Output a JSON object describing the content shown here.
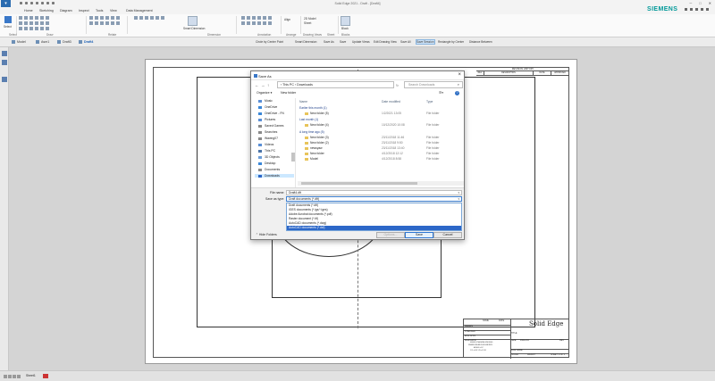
{
  "window": {
    "title": "Solid Edge 2021 - Draft - [Draft4]"
  },
  "menu": {
    "tabs": [
      "Home",
      "Sketching",
      "Diagram",
      "Inspect",
      "Tools",
      "View",
      "Data Management"
    ],
    "brand": "SIEMENS"
  },
  "ribbon": {
    "select_label": "Select",
    "groups": [
      "Select",
      "Draw",
      "Relate",
      "Dimension",
      "Annotation",
      "Arrange",
      "Drawing Views",
      "Sheet",
      "Blocks"
    ],
    "smart_dimension": "Smart Dimension",
    "tools": [
      "2D Model",
      "Sheet",
      "Block"
    ],
    "align": "Align",
    "arrange": "Arrange"
  },
  "doc_tabs": [
    "Model",
    "Asm1",
    "Draft3",
    "Draft4"
  ],
  "command_bar": [
    "Circle by Center Point",
    "Smart Dimension",
    "Save As",
    "Save",
    "Update Views",
    "Edit Drawing View",
    "Save All",
    "Save Session",
    "Rectangle by Center",
    "Distance Between"
  ],
  "sheet_tab": "Sheet1",
  "drawing": {
    "revision_history": "REVISION HISTORY",
    "rev_cols": [
      "REV",
      "DESCRIPTION",
      "DATE",
      "APPROVED"
    ],
    "title_block_brand": "Solid Edge",
    "title_block_texts": [
      "NAME",
      "DATE",
      "DRAWN",
      "CHECKED",
      "ENG APPR",
      "MGR APPR",
      "UNLESS OTHERWISE SPECIFIED",
      "DIMENSIONS ARE IN MILLIMETERS",
      "ANGLES ±X.X°",
      "2 PL ±X.XX 3 PL ±X.XXX",
      "SIZE",
      "DWG NO",
      "REV",
      "FILE NAME",
      "SCALE",
      "WEIGHT",
      "SHEET 1 OF 1",
      "TITLE"
    ]
  },
  "dialog": {
    "title": "Save As",
    "breadcrumb": "› This PC › Downloads",
    "search_placeholder": "Search Downloads",
    "organize": "Organize ▾",
    "new_folder": "New folder",
    "nav": [
      "Music",
      "OneDrive",
      "OneDrive - FN",
      "Pictures",
      "Saved Games",
      "Searches",
      "Waving07",
      "Videos",
      "This PC",
      "3D Objects",
      "Desktop",
      "Documents",
      "Downloads"
    ],
    "columns": [
      "Name",
      "Date modified",
      "Type"
    ],
    "groups": [
      "Earlier this month (1)",
      "Last month (1)",
      "A long time ago (5)"
    ],
    "files": [
      {
        "name": "New folder (5)",
        "date": "1/2/2021 13:05",
        "type": "File folder"
      },
      {
        "name": "New folder (4)",
        "date": "10/12/2020 10:08",
        "type": "File folder"
      },
      {
        "name": "New folder (3)",
        "date": "23/11/2018 11:46",
        "type": "File folder"
      },
      {
        "name": "New folder (2)",
        "date": "23/11/2018 9:50",
        "type": "File folder"
      },
      {
        "name": "newsyaw",
        "date": "23/11/2018 13:40",
        "type": "File folder"
      },
      {
        "name": "New folder",
        "date": "4/12/2018 12:12",
        "type": "File folder"
      },
      {
        "name": "Model",
        "date": "4/12/2018 8:58",
        "type": "File folder"
      }
    ],
    "file_name_label": "File name:",
    "file_name_value": "Draft4.dft",
    "save_type_label": "Save as type:",
    "save_type_value": "Draft documents (*.dft)",
    "type_options": [
      "Draft documents (*.dft)",
      "IGES documents (*.igs;*.iges)",
      "Adobe Acrobat documents (*.pdf)",
      "Raster document (*.tif)",
      "AutoCAD documents (*.dwg)",
      "AutoCAD documents (*.dxf)"
    ],
    "hide_folders": "Hide Folders",
    "options_btn": "Options...",
    "save_btn": "Save",
    "cancel_btn": "Cancel"
  }
}
